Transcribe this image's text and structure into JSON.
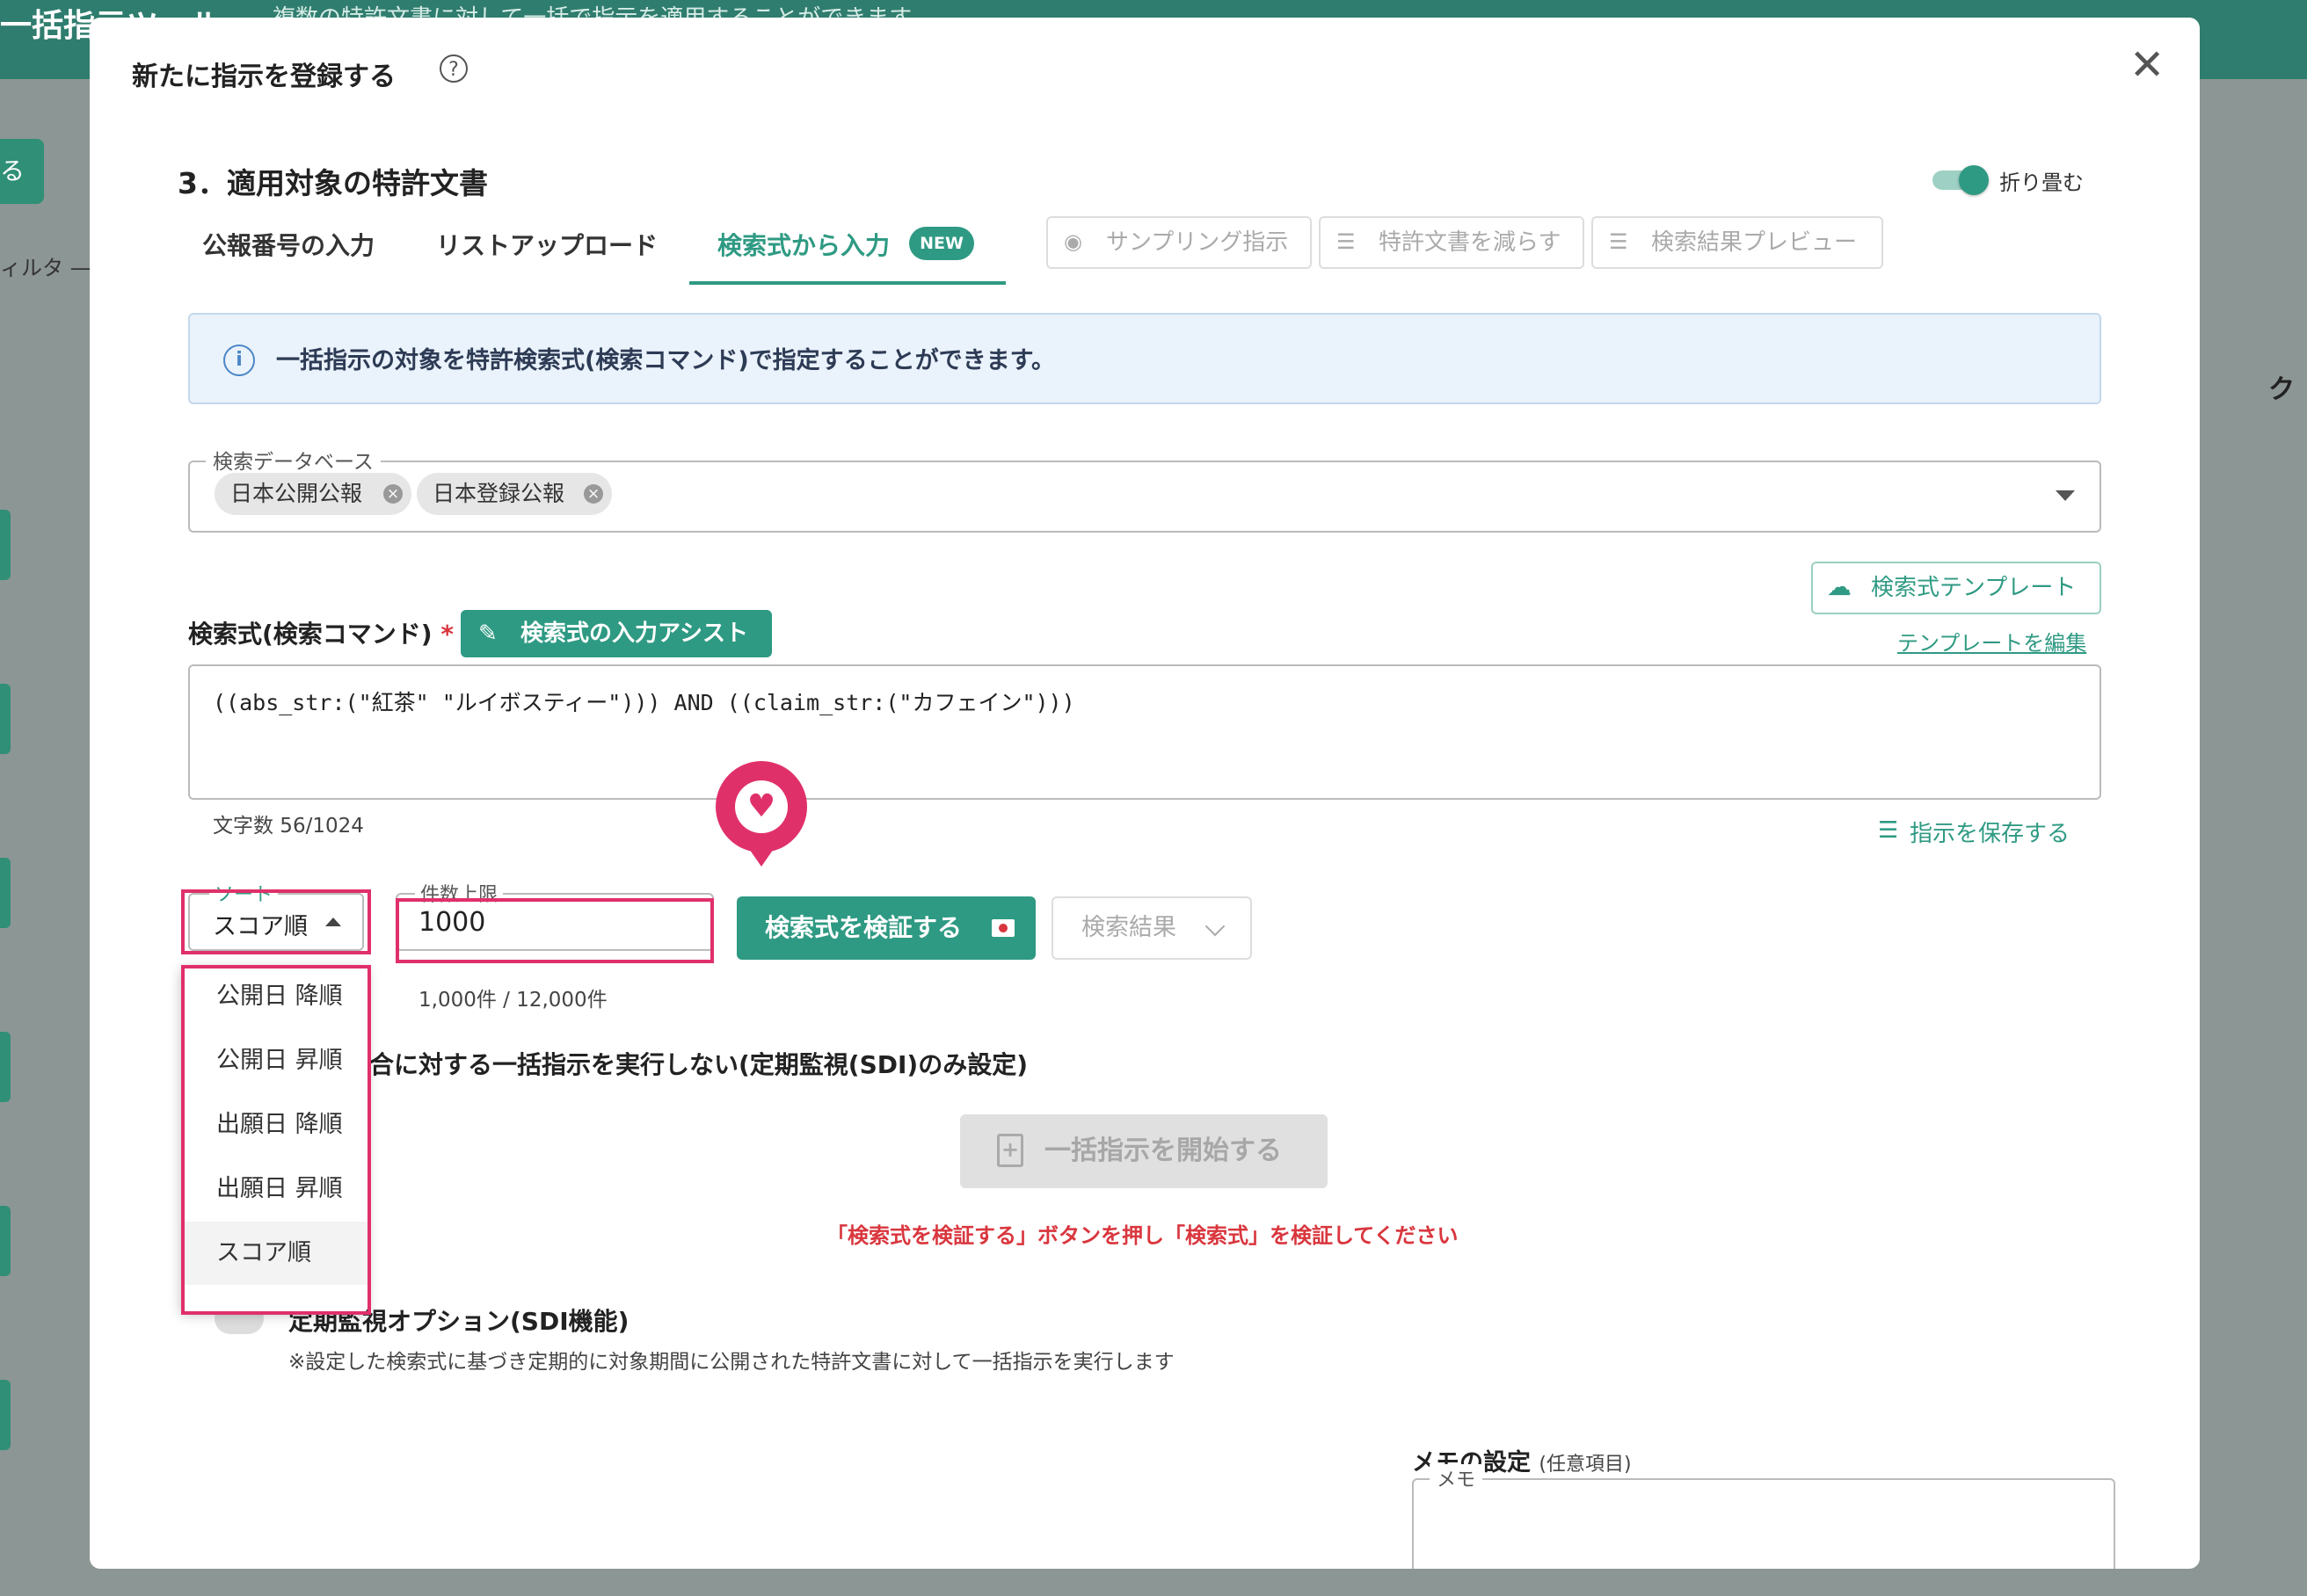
{
  "background": {
    "title": "一括指示ツール",
    "subtitle": "複数の特許文書に対して一括で指示を適用することができます",
    "button": "る",
    "filter": "ィルタ —",
    "right_label": "ク"
  },
  "modal": {
    "title": "新たに指示を登録する",
    "help": "?",
    "close": "✕",
    "section_title": "3．適用対象の特許文書",
    "collapse_label": "折り畳む",
    "tabs": [
      {
        "label": "公報番号の入力"
      },
      {
        "label": "リストアップロード"
      },
      {
        "label": "検索式から入力"
      }
    ],
    "new_badge": "NEW",
    "tools": [
      {
        "label": "サンプリング指示",
        "icon": "eye-icon"
      },
      {
        "label": "特許文書を減らす",
        "icon": "list-remove-icon"
      },
      {
        "label": "検索結果プレビュー",
        "icon": "list-check-icon"
      }
    ],
    "info_text": "一括指示の対象を特許検索式(検索コマンド)で指定することができます。",
    "database": {
      "label": "検索データベース",
      "chips": [
        "日本公開公報",
        "日本登録公報"
      ]
    },
    "template_button": "検索式テンプレート",
    "template_edit": "テンプレートを編集",
    "query": {
      "label": "検索式(検索コマンド)",
      "required": "*",
      "assist_button": "検索式の入力アシスト",
      "value": "((abs_str:(\"紅茶\" \"ルイボスティー\"))) AND ((claim_str:(\"カフェイン\")))",
      "char_count": "文字数 56/1024"
    },
    "save_instruction": "指示を保存する",
    "sort": {
      "label": "ソート",
      "value": "スコア順",
      "options": [
        "公開日 降順",
        "公開日 昇順",
        "出願日 降順",
        "出願日 昇順",
        "スコア順"
      ]
    },
    "limit": {
      "label": "件数上限",
      "value": "1000",
      "help": "1,000件 / 12,000件"
    },
    "verify_button": "検索式を検証する",
    "result_button": "検索結果",
    "sdi_only": "合に対する一括指示を実行しない(定期監視(SDI)のみ設定)",
    "start_button": "一括指示を開始する",
    "warning": "「検索式を検証する」ボタンを押し「検索式」を検証してください",
    "sdi_option_title": "定期監視オプション(SDI機能)",
    "sdi_option_desc": "※設定した検索式に基づき定期的に対象期間に公開された特許文書に対して一括指示を実行します",
    "memo": {
      "title": "メモの設定",
      "subtitle": "(任意項目)",
      "label": "メモ"
    }
  },
  "colors": {
    "accent": "#2f9a83",
    "highlight": "#e0306a",
    "warning": "#d9363e"
  }
}
